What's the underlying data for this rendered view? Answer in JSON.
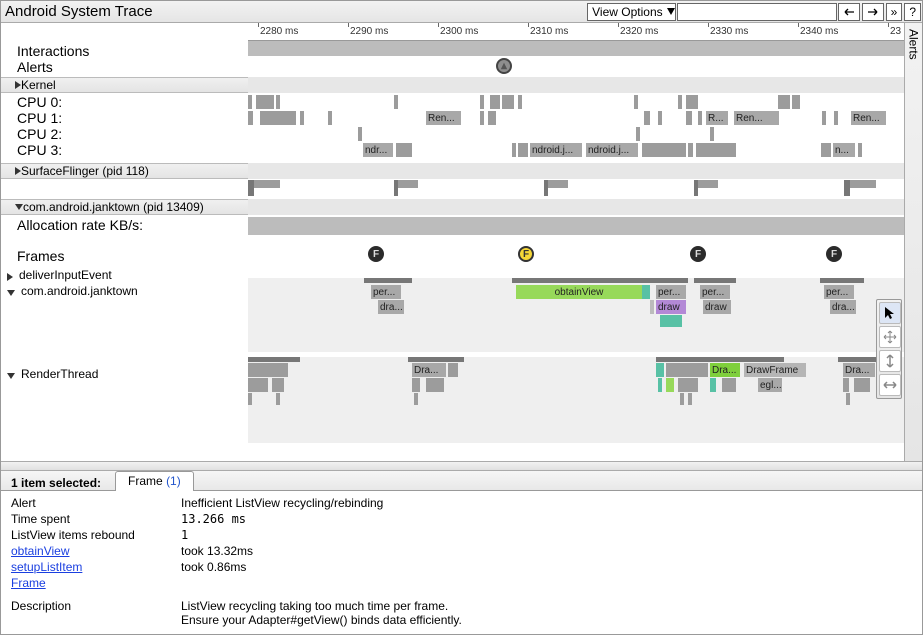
{
  "titlebar": {
    "title": "Android System Trace",
    "view_options": "View Options",
    "help": "?"
  },
  "ruler_ticks": [
    "2280 ms",
    "2290 ms",
    "2300 ms",
    "2310 ms",
    "2320 ms",
    "2330 ms",
    "2340 ms",
    "23"
  ],
  "labels": {
    "interactions": "Interactions",
    "alerts": "Alerts",
    "kernel": "Kernel",
    "cpu0": "CPU 0:",
    "cpu1": "CPU 1:",
    "cpu2": "CPU 2:",
    "cpu3": "CPU 3:",
    "surfaceflinger": "SurfaceFlinger (pid 118)",
    "janktown_proc": "com.android.janktown (pid 13409)",
    "alloc_rate": "Allocation rate KB/s:",
    "frames": "Frames",
    "deliver": "deliverInputEvent",
    "janktown": "com.android.janktown",
    "renderthread": "RenderThread"
  },
  "alerts_sidebar": "Alerts",
  "slices": {
    "cpu1_ren0": "Ren...",
    "cpu1_r": "R...",
    "cpu1_ren1": "Ren...",
    "cpu1_ren2": "Ren...",
    "cpu3_ndr": "ndr...",
    "cpu3_ndroid1": "ndroid.j...",
    "cpu3_ndroid2": "ndroid.j...",
    "cpu3_n": "n...",
    "jank_per0": "per...",
    "jank_dra0": "dra...",
    "jank_obtain": "obtainView",
    "jank_per1": "per...",
    "jank_draw": "draw",
    "jank_per2": "per...",
    "jank_draw2": "draw",
    "jank_per3": "per...",
    "jank_dra3": "dra...",
    "render_dra0": "Dra...",
    "render_dra1": "Dra...",
    "render_drawframe": "DrawFrame",
    "render_egl": "egl...",
    "render_dra2": "Dra..."
  },
  "frame_letter": "F",
  "selection": {
    "header": "1 item selected:",
    "tab_label": "Frame",
    "tab_count": "(1)"
  },
  "details": {
    "rows": [
      {
        "k": "Alert",
        "v": "Inefficient ListView recycling/rebinding"
      },
      {
        "k": "Time spent",
        "v": "13.266 ms",
        "mono": true
      },
      {
        "k": "ListView items rebound",
        "v": "1",
        "mono": true
      }
    ],
    "obtainView": {
      "link": "obtainView",
      "text": "took 13.32ms"
    },
    "setupListItem": {
      "link": "setupListItem",
      "text": "took 0.86ms"
    },
    "frame": {
      "link": "Frame"
    },
    "description_k": "Description",
    "description_v": "ListView recycling taking too much time per frame.\nEnsure your Adapter#getView() binds data efficiently."
  }
}
